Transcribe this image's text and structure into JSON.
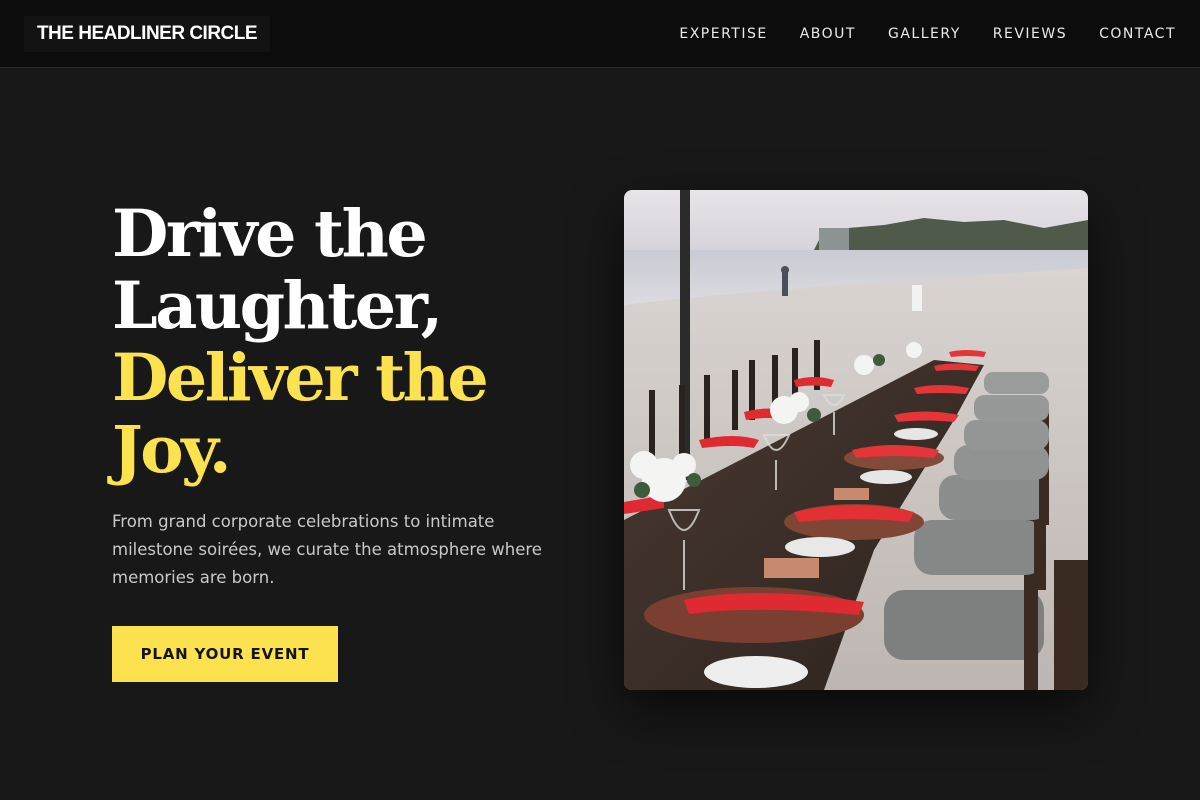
{
  "brand": {
    "name": "THE HEADLINER CIRCLE"
  },
  "nav": {
    "items": [
      {
        "label": "EXPERTISE"
      },
      {
        "label": "ABOUT"
      },
      {
        "label": "GALLERY"
      },
      {
        "label": "REVIEWS"
      },
      {
        "label": "CONTACT"
      }
    ]
  },
  "hero": {
    "headline_line1": "Drive the",
    "headline_line2": "Laughter,",
    "headline_line3": "Deliver the",
    "headline_line4": "Joy.",
    "subtext": "From grand corporate celebrations to intimate milestone soirées, we curate the atmosphere where memories are born.",
    "cta_label": "PLAN YOUR EVENT",
    "image_alt": "Long dinner table set on a beach with red napkins"
  },
  "colors": {
    "accent": "#fde24f",
    "background": "#181818",
    "navbar": "#0c0c0c"
  }
}
